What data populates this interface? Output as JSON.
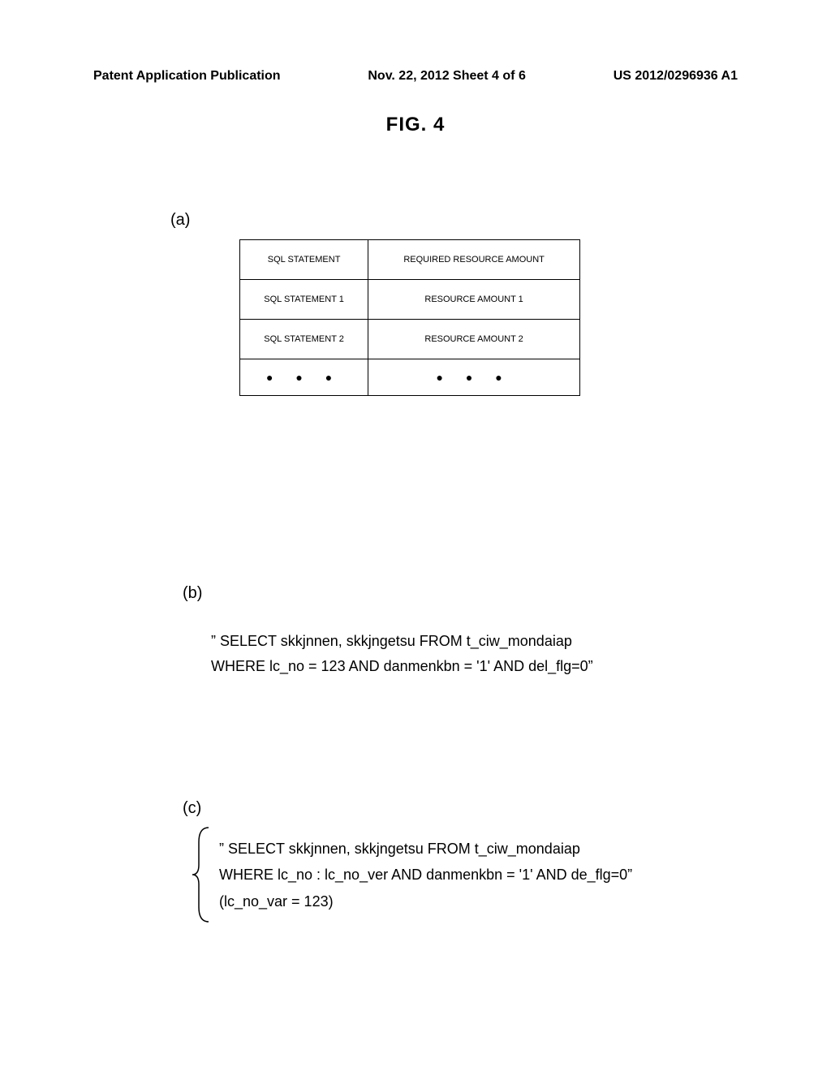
{
  "header": {
    "left": "Patent Application Publication",
    "center": "Nov. 22, 2012  Sheet 4 of 6",
    "right": "US 2012/0296936 A1"
  },
  "figLabel": "FIG. 4",
  "sections": {
    "a": "(a)",
    "b": "(b)",
    "c": "(c)"
  },
  "table": {
    "headers": [
      "SQL STATEMENT",
      "REQUIRED RESOURCE AMOUNT"
    ],
    "rows": [
      [
        "SQL STATEMENT 1",
        "RESOURCE AMOUNT 1"
      ],
      [
        "SQL STATEMENT 2",
        "RESOURCE AMOUNT 2"
      ]
    ],
    "dots": [
      "●   ●   ●",
      "●   ●   ●"
    ]
  },
  "codeB": {
    "line1": "” SELECT skkjnnen, skkjngetsu FROM t_ciw_mondaiap",
    "line2": "WHERE lc_no = 123 AND danmenkbn = '1' AND del_flg=0”"
  },
  "codeC": {
    "line1": "” SELECT skkjnnen, skkjngetsu FROM t_ciw_mondaiap",
    "line2": "WHERE lc_no : lc_no_ver  AND danmenkbn = '1' AND de_flg=0”",
    "line3": "(lc_no_var = 123)"
  }
}
